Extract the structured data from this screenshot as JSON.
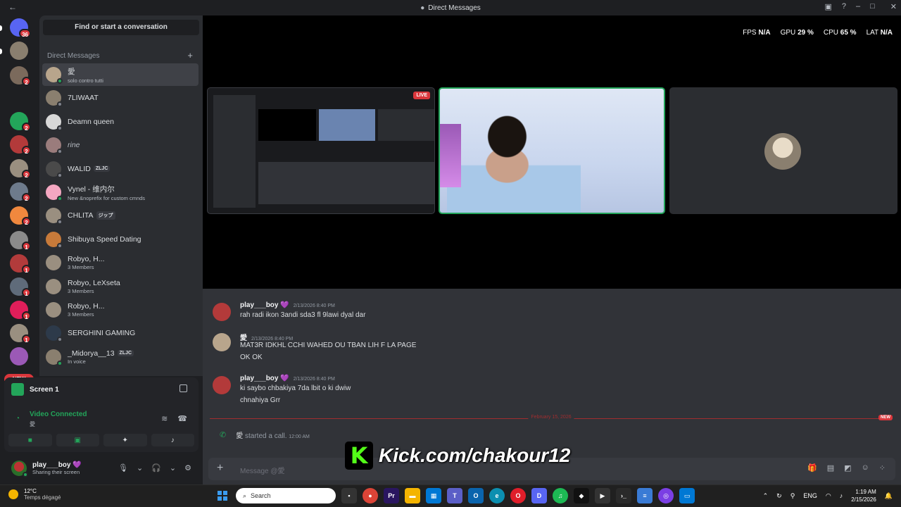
{
  "window": {
    "title": "Direct Messages"
  },
  "servers": {
    "items": [
      {
        "name": "discord-home",
        "badge": "36",
        "color": "#5865f2"
      },
      {
        "name": "server-1",
        "badge": "",
        "color": "#8a7f6f"
      },
      {
        "name": "server-2",
        "badge": "2",
        "color": "#7b6a5c"
      },
      {
        "name": "server-3",
        "badge": "2",
        "color": "#23a55a"
      },
      {
        "name": "server-4",
        "badge": "2",
        "color": "#b33a3a"
      },
      {
        "name": "server-5",
        "badge": "2",
        "color": "#9a8f80"
      },
      {
        "name": "server-6",
        "badge": "2",
        "color": "#6e7b8c"
      },
      {
        "name": "server-7",
        "badge": "2",
        "color": "#f0883e"
      },
      {
        "name": "server-8",
        "badge": "1",
        "color": "#8b8b8b"
      },
      {
        "name": "server-9",
        "badge": "1",
        "color": "#b23b3b"
      },
      {
        "name": "server-10",
        "badge": "1",
        "color": "#5f6b7a"
      },
      {
        "name": "server-11",
        "badge": "1",
        "color": "#e01e5a"
      },
      {
        "name": "server-12",
        "badge": "1",
        "color": "#9a8f80"
      },
      {
        "name": "server-13",
        "badge": "",
        "color": "#9b59b6"
      }
    ],
    "new_label": "NEW"
  },
  "dm": {
    "search_label": "Find or start a conversation",
    "header": "Direct Messages",
    "add_icon": "plus-icon",
    "items": [
      {
        "name": "愛",
        "status": "solo contro tutti",
        "online": true,
        "color": "#b8a58c",
        "tag": ""
      },
      {
        "name": "7LIWAAT",
        "status": "",
        "online": false,
        "color": "#8a7f6f",
        "tag": ""
      },
      {
        "name": "Deamn queen",
        "status": "",
        "online": false,
        "color": "#d8d8d8",
        "tag": ""
      },
      {
        "name": "rine",
        "status": "",
        "online": false,
        "color": "#9a7c7c",
        "tag": "",
        "italic": true
      },
      {
        "name": "WALID",
        "status": "",
        "online": false,
        "color": "#4a4a4a",
        "tag": "ZLJC"
      },
      {
        "name": "Vynel - 维内尔",
        "status": "New &noprefix for custom cmnds",
        "online": true,
        "color": "#f4a7c1",
        "tag": ""
      },
      {
        "name": "CHLITA",
        "status": "",
        "online": false,
        "color": "#9a8f80",
        "tag": "ジップ"
      },
      {
        "name": "Shibuya Speed Dating",
        "status": "",
        "online": false,
        "color": "#c77a3a",
        "tag": ""
      },
      {
        "name": "Robyo, H...",
        "status": "3 Members",
        "online": false,
        "color": "#9a8f80",
        "tag": ""
      },
      {
        "name": "Robyo, LeXseta",
        "status": "3 Members",
        "online": false,
        "color": "#9a8f80",
        "tag": ""
      },
      {
        "name": "Robyo, H...",
        "status": "3 Members",
        "online": false,
        "color": "#9a8f80",
        "tag": ""
      },
      {
        "name": "SERGHINI GAMING",
        "status": "",
        "online": false,
        "color": "#2d3a4a",
        "tag": ""
      },
      {
        "name": "_Midorya__13",
        "status": "In voice",
        "online": true,
        "color": "#8a7f6f",
        "tag": "ZLJC"
      }
    ]
  },
  "voice": {
    "stream_label": "Screen 1",
    "connected": "Video Connected",
    "channel": "愛"
  },
  "user": {
    "name": "play___boy 💜",
    "status": "Sharing their screen"
  },
  "stats": {
    "fps_label": "FPS",
    "fps": "N/A",
    "gpu_label": "GPU",
    "gpu": "29 %",
    "cpu_label": "CPU",
    "cpu": "65 %",
    "lat_label": "LAT",
    "lat": "N/A"
  },
  "call": {
    "live_label": "LIVE"
  },
  "messages": [
    {
      "author": "play___boy 💜",
      "time": "2/13/2026 8:40 PM",
      "lines": [
        "rah radi ikon 3andi sda3 fl 9lawi dyal dar"
      ],
      "color": "#b33a3a"
    },
    {
      "author": "愛",
      "time": "2/13/2026 8:40 PM",
      "lines": [
        "MAT3R IDKHL CCHI WAHED OU TBAN LIH F LA PAGE",
        "OK OK"
      ],
      "color": "#b8a58c"
    },
    {
      "author": "play___boy 💜",
      "time": "2/13/2026 8:40 PM",
      "lines": [
        "ki saybo chbakiya 7da lbit o ki dwiw",
        "chnahiya Grr"
      ],
      "color": "#b33a3a"
    }
  ],
  "divider": {
    "date": "February 15, 2026",
    "new": "NEW"
  },
  "system": {
    "author": "愛",
    "text": "started a call.",
    "time": "12:00 AM"
  },
  "compose": {
    "placeholder": "Message @愛"
  },
  "overlay": {
    "kick_text": "Kick.com/chakour12",
    "kick_logo": "K"
  },
  "taskbar": {
    "temp": "12°C",
    "weather": "Temps dégagé",
    "search": "Search",
    "lang": "ENG",
    "time": "1:19 AM",
    "date": "2/15/2026"
  }
}
